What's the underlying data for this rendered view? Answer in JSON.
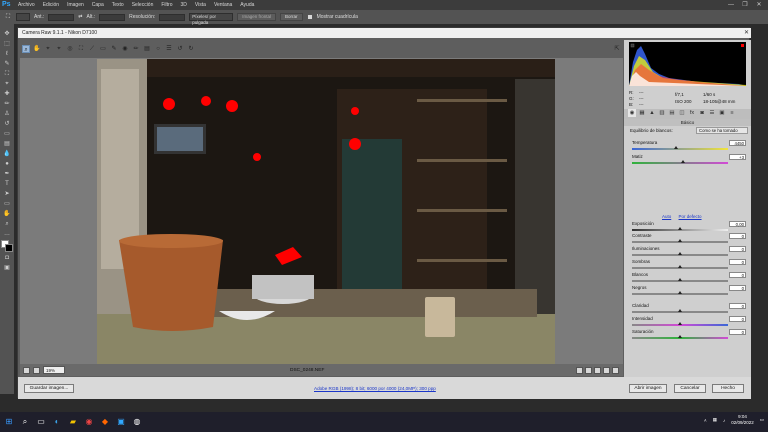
{
  "app": {
    "logo": "Ps"
  },
  "menu": [
    "Archivo",
    "Edición",
    "Imagen",
    "Capa",
    "Texto",
    "Selección",
    "Filtro",
    "3D",
    "Vista",
    "Ventana",
    "Ayuda"
  ],
  "window_controls": [
    "—",
    "❐",
    "✕"
  ],
  "options_bar": {
    "label_ant": "Ant.:",
    "label_alt": "Alt.:",
    "label_resolution": "Resolución:",
    "units": "Píxeles/ por pulgada",
    "front_image": "Imagen frontal",
    "clear": "Borrar",
    "show_grid": "Mostrar cuadrícula"
  },
  "dialog": {
    "title": "Camera Raw 9.1.1 - Nikon D7100",
    "close": "✕"
  },
  "preview": {
    "zoom": "19%",
    "filename": "DSC_0248.NEF"
  },
  "footer": {
    "save": "Guardar imagen...",
    "workflow": "Adobe RGB (1998); 8 bit; 6000 por 4000 (24,0MP); 300 ppp",
    "open": "Abrir imagen",
    "cancel": "Cancelar",
    "done": "Hecho"
  },
  "readout": {
    "r": "R:",
    "g": "G:",
    "b": "B:",
    "r_val": "---",
    "g_val": "---",
    "b_val": "---",
    "aperture": "f/7,1",
    "shutter": "1/60 s",
    "iso": "ISO 200",
    "lens": "18-105@48 mm"
  },
  "panel": {
    "section": "Básico",
    "wb_label": "Equilibrio de blancos:",
    "wb_value": "Como se ha tomado",
    "auto": "Auto",
    "default": "Por defecto"
  },
  "controls": [
    {
      "label": "Temperatura",
      "value": "4450"
    },
    {
      "label": "Matiz",
      "value": "+3"
    },
    {
      "label": "Exposición",
      "value": "0,00"
    },
    {
      "label": "Contraste",
      "value": "0"
    },
    {
      "label": "Iluminaciones",
      "value": "0"
    },
    {
      "label": "Sombras",
      "value": "0"
    },
    {
      "label": "Blancos",
      "value": "0"
    },
    {
      "label": "Negros",
      "value": "0"
    },
    {
      "label": "Claridad",
      "value": "0"
    },
    {
      "label": "Intensidad",
      "value": "0"
    },
    {
      "label": "Saturación",
      "value": "0"
    }
  ],
  "taskbar": {
    "time": "9:04",
    "date": "02/09/2022"
  },
  "colors": {
    "clip_warning": "#ff0000",
    "link": "#1b37c9",
    "ps_blue": "#31a8ff"
  }
}
